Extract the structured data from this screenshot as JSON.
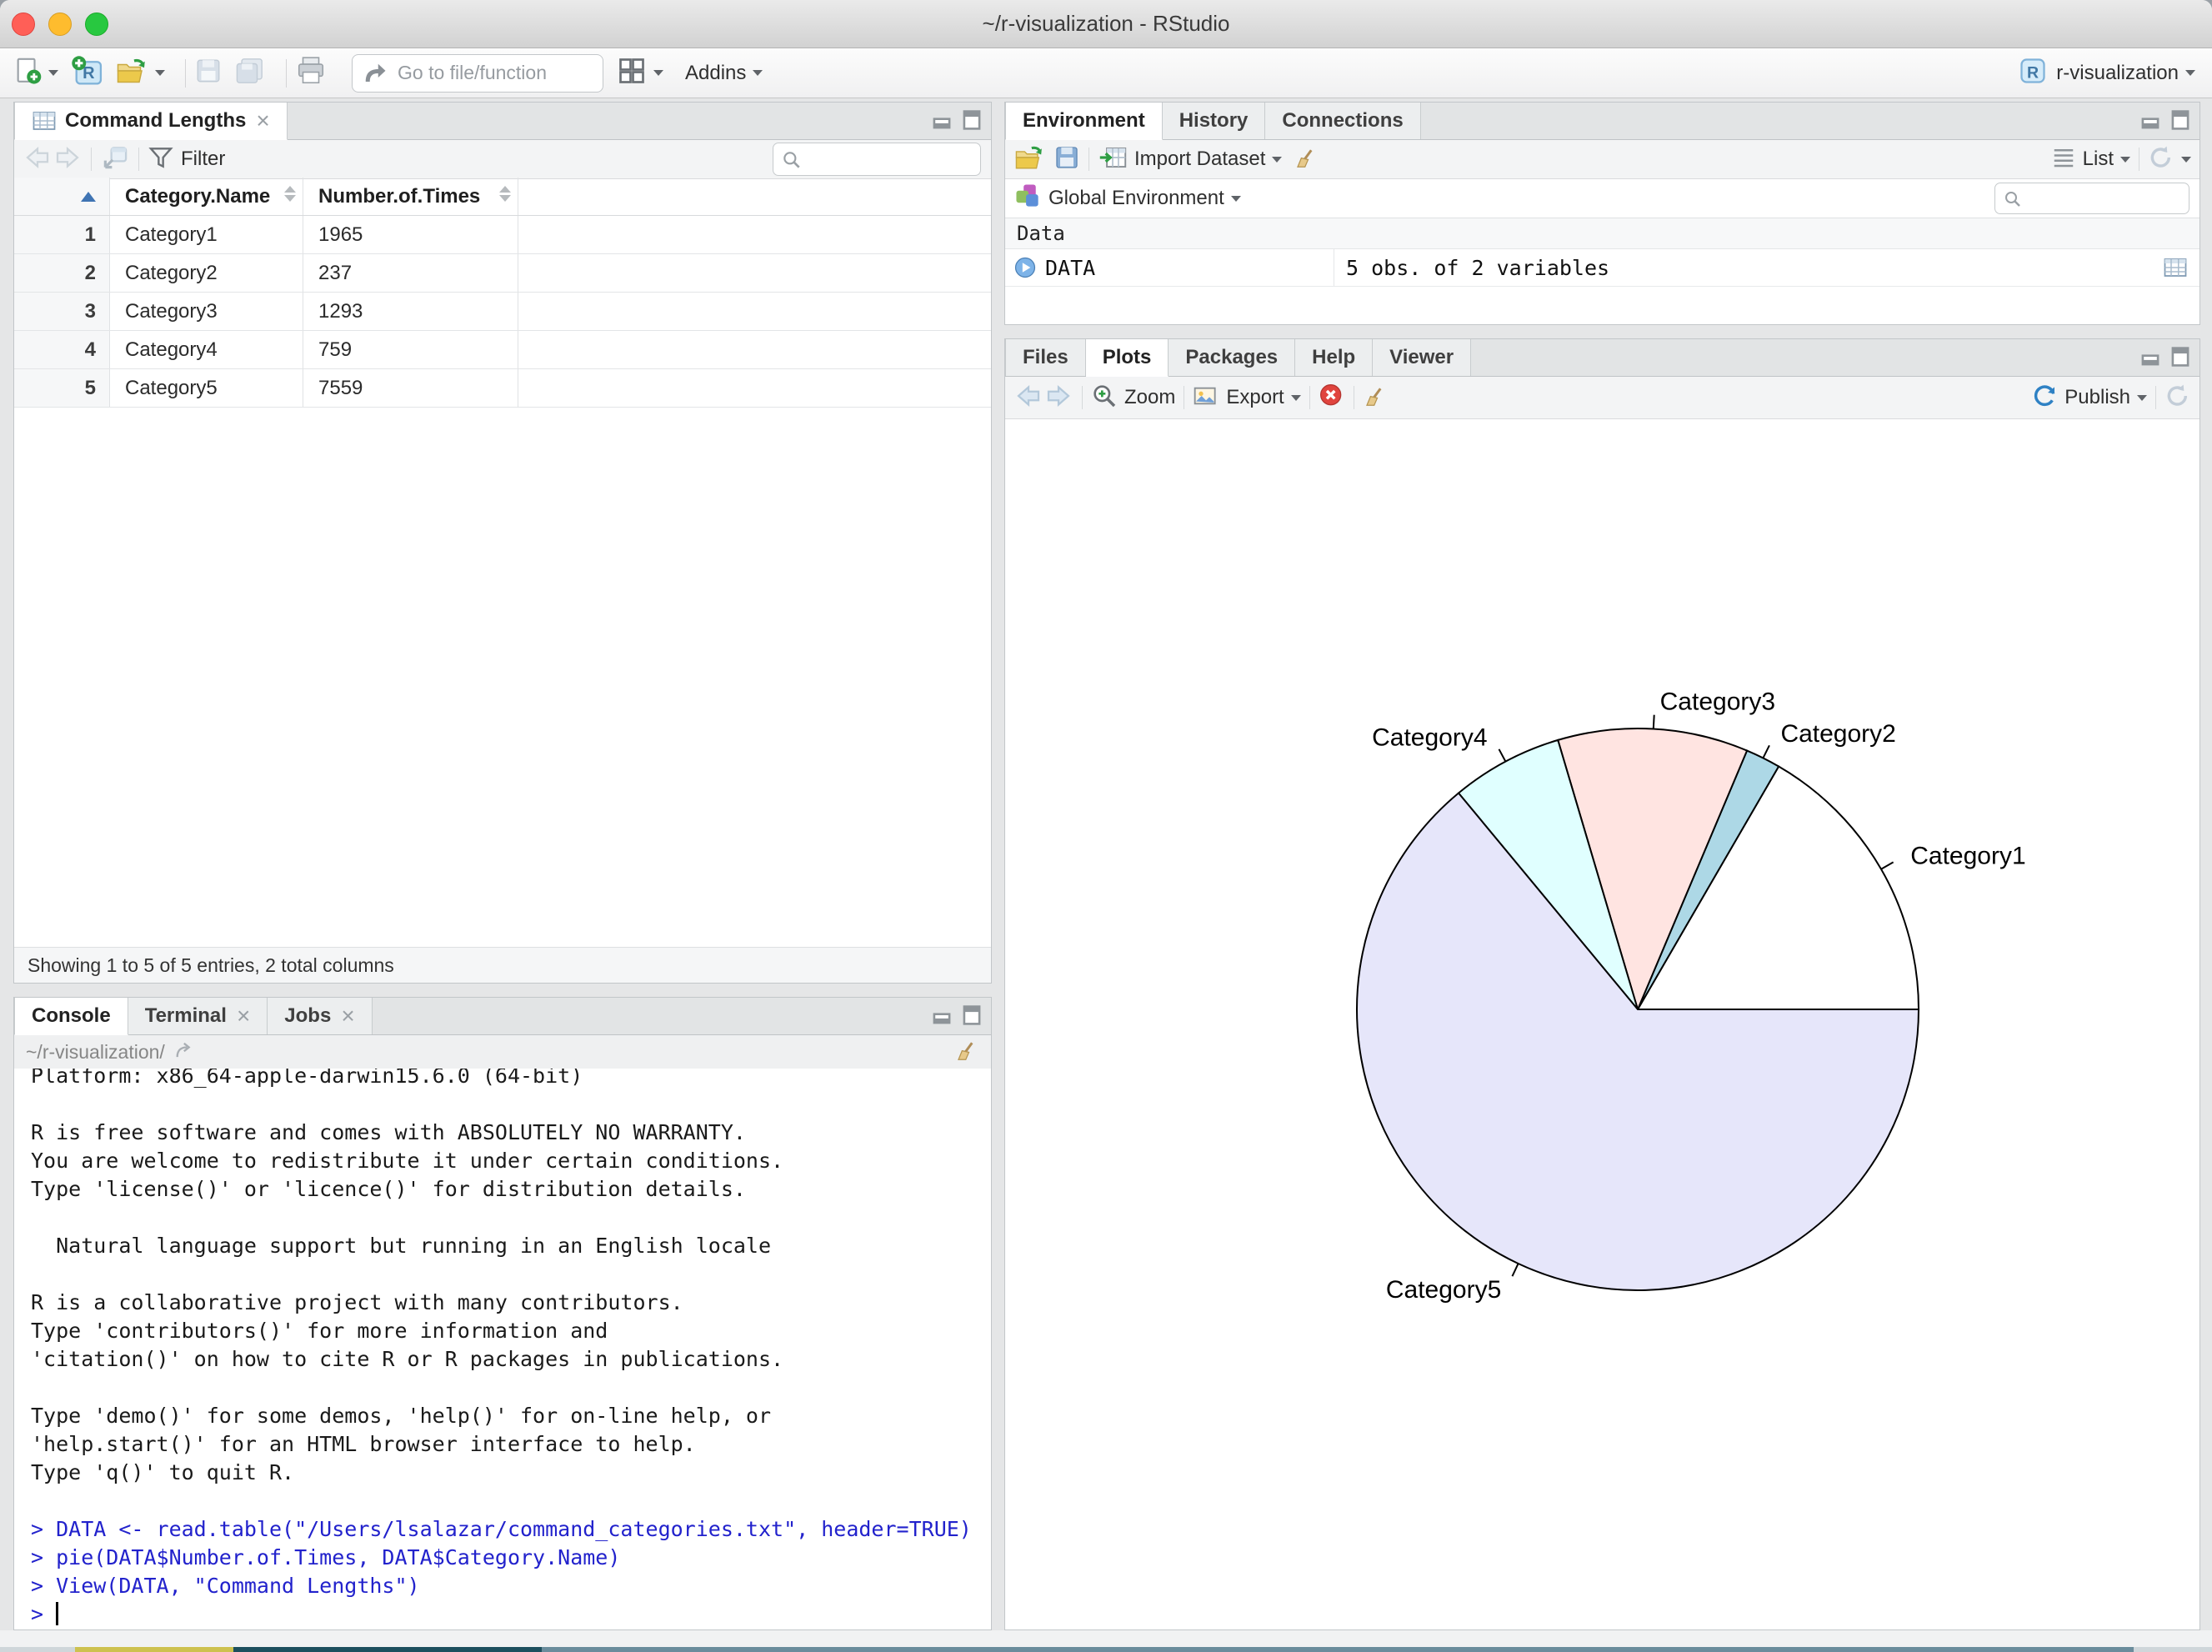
{
  "window": {
    "title": "~/r-visualization - RStudio"
  },
  "main_toolbar": {
    "goto_placeholder": "Go to file/function",
    "addins_label": "Addins",
    "project_label": "r-visualization"
  },
  "data_viewer": {
    "tab_label": "Command Lengths",
    "filter_label": "Filter",
    "columns": [
      "Category.Name",
      "Number.of.Times"
    ],
    "rows": [
      {
        "num": "1",
        "name": "Category1",
        "times": "1965"
      },
      {
        "num": "2",
        "name": "Category2",
        "times": "237"
      },
      {
        "num": "3",
        "name": "Category3",
        "times": "1293"
      },
      {
        "num": "4",
        "name": "Category4",
        "times": "759"
      },
      {
        "num": "5",
        "name": "Category5",
        "times": "7559"
      }
    ],
    "status": "Showing 1 to 5 of 5 entries, 2 total columns"
  },
  "environment": {
    "tabs": [
      "Environment",
      "History",
      "Connections"
    ],
    "import_label": "Import Dataset",
    "list_label": "List",
    "scope_label": "Global Environment",
    "section_label": "Data",
    "object_name": "DATA",
    "object_desc": "5 obs. of 2 variables"
  },
  "plots": {
    "tabs": [
      "Files",
      "Plots",
      "Packages",
      "Help",
      "Viewer"
    ],
    "zoom_label": "Zoom",
    "export_label": "Export",
    "publish_label": "Publish"
  },
  "console": {
    "tabs": [
      "Console",
      "Terminal",
      "Jobs"
    ],
    "path": "~/r-visualization/",
    "prompt": ">",
    "lines": [
      {
        "text": "Platform: x86_64-apple-darwin15.6.0 (64-bit)",
        "type": "output"
      },
      {
        "text": "",
        "type": "output"
      },
      {
        "text": "R is free software and comes with ABSOLUTELY NO WARRANTY.",
        "type": "output"
      },
      {
        "text": "You are welcome to redistribute it under certain conditions.",
        "type": "output"
      },
      {
        "text": "Type 'license()' or 'licence()' for distribution details.",
        "type": "output"
      },
      {
        "text": "",
        "type": "output"
      },
      {
        "text": "  Natural language support but running in an English locale",
        "type": "output"
      },
      {
        "text": "",
        "type": "output"
      },
      {
        "text": "R is a collaborative project with many contributors.",
        "type": "output"
      },
      {
        "text": "Type 'contributors()' for more information and",
        "type": "output"
      },
      {
        "text": "'citation()' on how to cite R or R packages in publications.",
        "type": "output"
      },
      {
        "text": "",
        "type": "output"
      },
      {
        "text": "Type 'demo()' for some demos, 'help()' for on-line help, or",
        "type": "output"
      },
      {
        "text": "'help.start()' for an HTML browser interface to help.",
        "type": "output"
      },
      {
        "text": "Type 'q()' to quit R.",
        "type": "output"
      },
      {
        "text": "",
        "type": "output"
      },
      {
        "text": "> DATA <- read.table(\"/Users/lsalazar/command_categories.txt\", header=TRUE)",
        "type": "input"
      },
      {
        "text": "> pie(DATA$Number.of.Times, DATA$Category.Name)",
        "type": "input"
      },
      {
        "text": "> View(DATA, \"Command Lengths\")",
        "type": "input"
      }
    ]
  },
  "chart_data": {
    "type": "pie",
    "categories": [
      "Category1",
      "Category2",
      "Category3",
      "Category4",
      "Category5"
    ],
    "values": [
      1965,
      237,
      1293,
      759,
      7559
    ],
    "colors": [
      "#FFFFFF",
      "#ADD8E6",
      "#FFE4E1",
      "#E0FFFF",
      "#E6E6FA"
    ],
    "start_angle_deg": 0,
    "direction": "counterclockwise",
    "title": "",
    "stroke_color": "#000000",
    "label_font_px": 30
  }
}
